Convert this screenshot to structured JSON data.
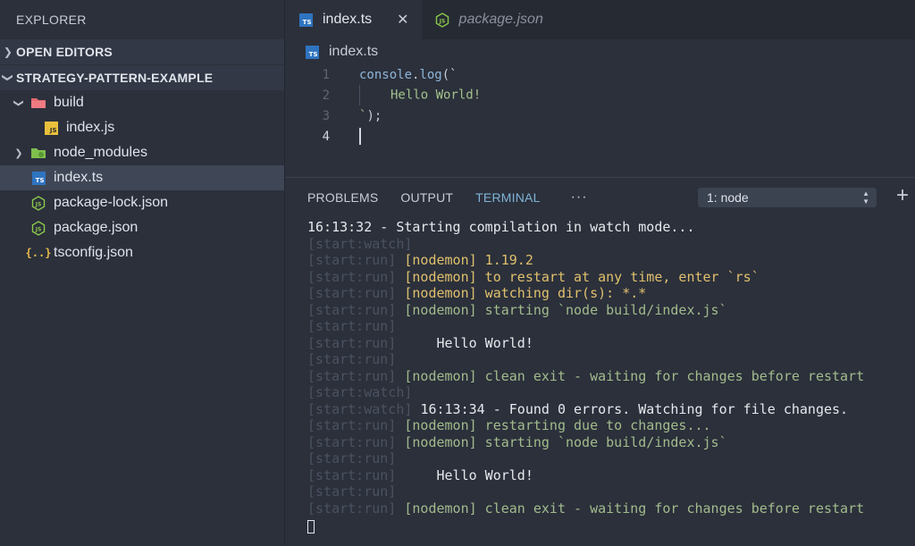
{
  "sidebar": {
    "header": "EXPLORER",
    "sections": {
      "open_editors": "OPEN EDITORS",
      "project": "STRATEGY-PATTERN-EXAMPLE"
    },
    "items": [
      {
        "label": "build",
        "type": "folder",
        "icon": "folder-open-icon"
      },
      {
        "label": "index.js",
        "type": "js"
      },
      {
        "label": "node_modules",
        "type": "folder",
        "icon": "folder-icon"
      },
      {
        "label": "index.ts",
        "type": "ts"
      },
      {
        "label": "package-lock.json",
        "type": "node"
      },
      {
        "label": "package.json",
        "type": "node"
      },
      {
        "label": "tsconfig.json",
        "type": "braces"
      }
    ]
  },
  "editor": {
    "tabs": [
      {
        "label": "index.ts",
        "close": "✕"
      },
      {
        "label": "package.json"
      }
    ],
    "breadcrumb": "index.ts",
    "lines": [
      {
        "num": "1",
        "fn": "console",
        "dot": ".",
        "method": "log",
        "rest": "(`"
      },
      {
        "num": "2",
        "text": "Hello World!"
      },
      {
        "num": "3",
        "text": "`);"
      },
      {
        "num": "4",
        "text": ""
      }
    ]
  },
  "panel": {
    "tabs": [
      "PROBLEMS",
      "OUTPUT",
      "TERMINAL"
    ],
    "more": "···",
    "select": "1: node",
    "plus": "+",
    "terminal": [
      {
        "prefix": "",
        "text": "16:13:32 - Starting compilation in watch mode...",
        "color": "wht"
      },
      {
        "prefix": "[start:watch]",
        "text": "",
        "color": "wht"
      },
      {
        "prefix": "[start:run] ",
        "text": "[nodemon] 1.19.2",
        "color": "yel"
      },
      {
        "prefix": "[start:run] ",
        "text": "[nodemon] to restart at any time, enter `rs`",
        "color": "yel"
      },
      {
        "prefix": "[start:run] ",
        "text": "[nodemon] watching dir(s): *.*",
        "color": "yel"
      },
      {
        "prefix": "[start:run] ",
        "text": "[nodemon] starting `node build/index.js`",
        "color": "grn"
      },
      {
        "prefix": "[start:run]",
        "text": "",
        "color": "wht"
      },
      {
        "prefix": "[start:run] ",
        "text": "    Hello World!",
        "color": "wht"
      },
      {
        "prefix": "[start:run]",
        "text": "",
        "color": "wht"
      },
      {
        "prefix": "[start:run] ",
        "text": "[nodemon] clean exit - waiting for changes before restart",
        "color": "grn"
      },
      {
        "prefix": "[start:watch]",
        "text": "",
        "color": "wht"
      },
      {
        "prefix": "[start:watch] ",
        "text": "16:13:34 - Found 0 errors. Watching for file changes.",
        "color": "wht"
      },
      {
        "prefix": "[start:run] ",
        "text": "[nodemon] restarting due to changes...",
        "color": "grn"
      },
      {
        "prefix": "[start:run] ",
        "text": "[nodemon] starting `node build/index.js`",
        "color": "grn"
      },
      {
        "prefix": "[start:run]",
        "text": "",
        "color": "wht"
      },
      {
        "prefix": "[start:run] ",
        "text": "    Hello World!",
        "color": "wht"
      },
      {
        "prefix": "[start:run]",
        "text": "",
        "color": "wht"
      },
      {
        "prefix": "[start:run] ",
        "text": "[nodemon] clean exit - waiting for changes before restart",
        "color": "grn"
      }
    ]
  }
}
